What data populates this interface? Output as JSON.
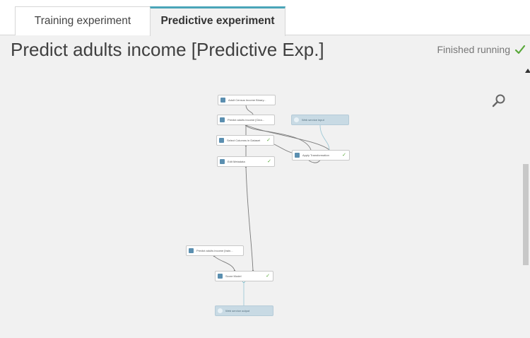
{
  "tabs": [
    {
      "label": "Training experiment",
      "active": false
    },
    {
      "label": "Predictive experiment",
      "active": true
    }
  ],
  "title": "Predict adults income [Predictive Exp.]",
  "status": {
    "text": "Finished running",
    "color": "#59a83a"
  },
  "accent": "#4aa5b8",
  "nodes": [
    {
      "label": "Adult Census Income Binary...",
      "icon": "dataset-icon",
      "completed": false
    },
    {
      "label": "Predict adults income [Clea...",
      "icon": "transform-icon",
      "completed": false
    },
    {
      "label": "Web service input",
      "icon": "web-service-input-icon",
      "completed": false
    },
    {
      "label": "Select Columns in Dataset",
      "icon": "module-icon",
      "completed": true
    },
    {
      "label": "Apply Transformation",
      "icon": "module-icon",
      "completed": true
    },
    {
      "label": "Edit Metadata",
      "icon": "module-icon",
      "completed": true
    },
    {
      "label": "Predict adults income [train...",
      "icon": "trained-model-icon",
      "completed": false
    },
    {
      "label": "Score Model",
      "icon": "module-icon",
      "completed": true
    },
    {
      "label": "Web service output",
      "icon": "web-service-output-icon",
      "completed": false
    }
  ]
}
